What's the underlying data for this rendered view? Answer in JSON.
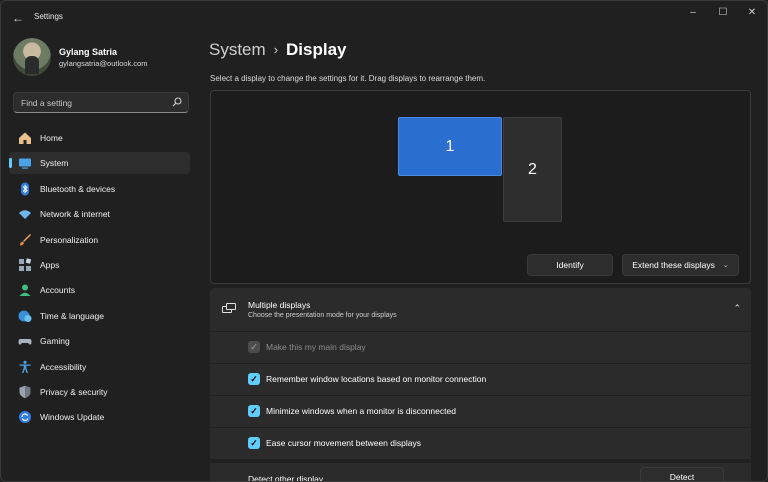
{
  "app": {
    "title": "Settings",
    "back": "←",
    "minimize": "–",
    "maximize": "☐",
    "close": "✕"
  },
  "user": {
    "name": "Gylang Satria",
    "email": "gylangsatria@outlook.com"
  },
  "search": {
    "placeholder": "Find a setting"
  },
  "nav": [
    {
      "label": "Home",
      "icon": "home-icon"
    },
    {
      "label": "System",
      "icon": "system-icon",
      "active": true
    },
    {
      "label": "Bluetooth & devices",
      "icon": "bluetooth-icon"
    },
    {
      "label": "Network & internet",
      "icon": "wifi-icon"
    },
    {
      "label": "Personalization",
      "icon": "brush-icon"
    },
    {
      "label": "Apps",
      "icon": "apps-icon"
    },
    {
      "label": "Accounts",
      "icon": "accounts-icon"
    },
    {
      "label": "Time & language",
      "icon": "globe-icon"
    },
    {
      "label": "Gaming",
      "icon": "gamepad-icon"
    },
    {
      "label": "Accessibility",
      "icon": "accessibility-icon"
    },
    {
      "label": "Privacy & security",
      "icon": "shield-icon"
    },
    {
      "label": "Windows Update",
      "icon": "update-icon"
    }
  ],
  "breadcrumb": {
    "parent": "System",
    "separator": "›",
    "current": "Display"
  },
  "intro": "Select a display to change the settings for it. Drag displays to rearrange them.",
  "displays": {
    "monitor1": "1",
    "monitor2": "2",
    "identify": "Identify",
    "extend": "Extend these displays",
    "extend_chevron": "⌄"
  },
  "multiple_displays": {
    "title": "Multiple displays",
    "subtitle": "Choose the presentation mode for your displays",
    "chevron": "⌃",
    "options": [
      {
        "label": "Make this my main display",
        "checked": true,
        "disabled": true
      },
      {
        "label": "Remember window locations based on monitor connection",
        "checked": true,
        "disabled": false
      },
      {
        "label": "Minimize windows when a monitor is disconnected",
        "checked": true,
        "disabled": false
      },
      {
        "label": "Ease cursor movement between displays",
        "checked": true,
        "disabled": false
      }
    ],
    "detect_label": "Detect other display",
    "detect_button": "Detect"
  },
  "colors": {
    "accent": "#60cdff",
    "monitor_selected": "#2a6fcf",
    "background": "#202020",
    "card": "#2b2b2b"
  }
}
